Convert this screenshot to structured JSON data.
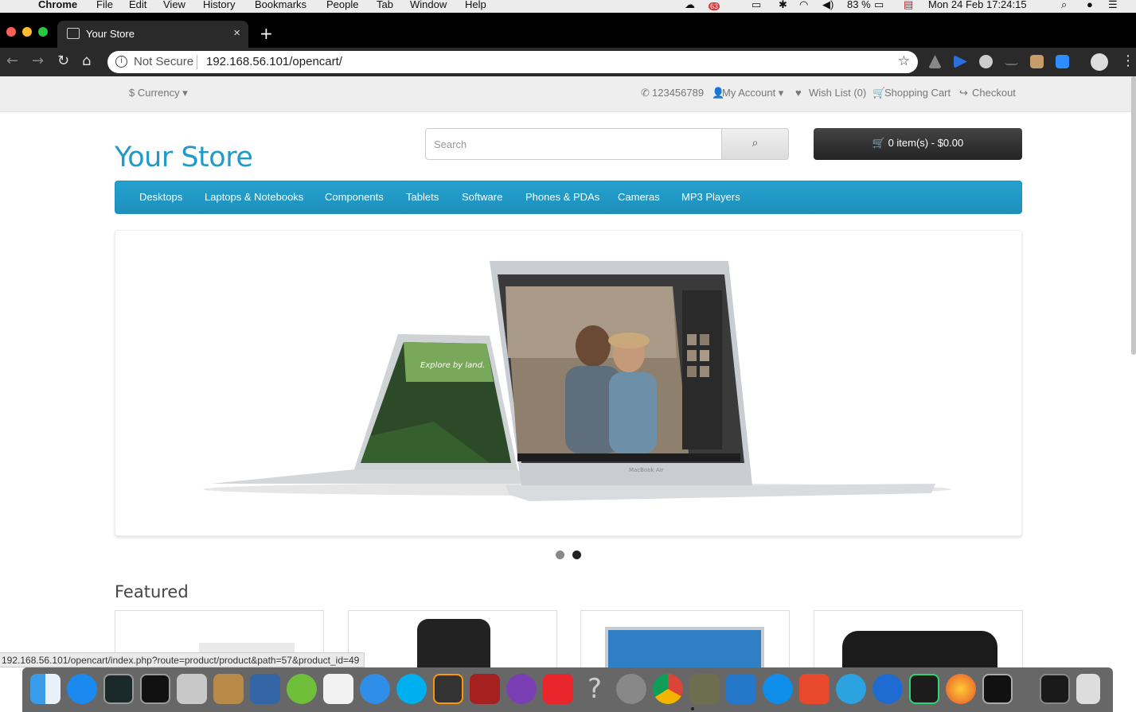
{
  "menubar": {
    "app": "Chrome",
    "items": [
      "File",
      "Edit",
      "View",
      "History",
      "Bookmarks",
      "People",
      "Tab",
      "Window",
      "Help"
    ],
    "battery": "83 %",
    "clock": "Mon 24 Feb  17:24:15",
    "badge": "63"
  },
  "tab": {
    "title": "Your Store",
    "close": "×",
    "new": "+"
  },
  "omnibox": {
    "security": "Not Secure",
    "url": "192.168.56.101/opencart/"
  },
  "topnav": {
    "currency": "$ Currency ▾",
    "phone": "123456789",
    "account": "My Account ▾",
    "wishlist": "Wish List (0)",
    "cart": "Shopping Cart",
    "checkout": "Checkout"
  },
  "header": {
    "logo": "Your Store",
    "search_placeholder": "Search",
    "cart_button": "0 item(s) - $0.00"
  },
  "menu": [
    "Desktops",
    "Laptops & Notebooks",
    "Components",
    "Tablets",
    "Software",
    "Phones & PDAs",
    "Cameras",
    "MP3 Players"
  ],
  "slideshow": {
    "explore_text": "Explore by land."
  },
  "featured_title": "Featured",
  "status_url": "192.168.56.101/opencart/index.php?route=product/product&path=57&product_id=49",
  "colors": {
    "brand": "#229ac8",
    "menu": "#229ac8",
    "cart_btn": "#303030"
  }
}
